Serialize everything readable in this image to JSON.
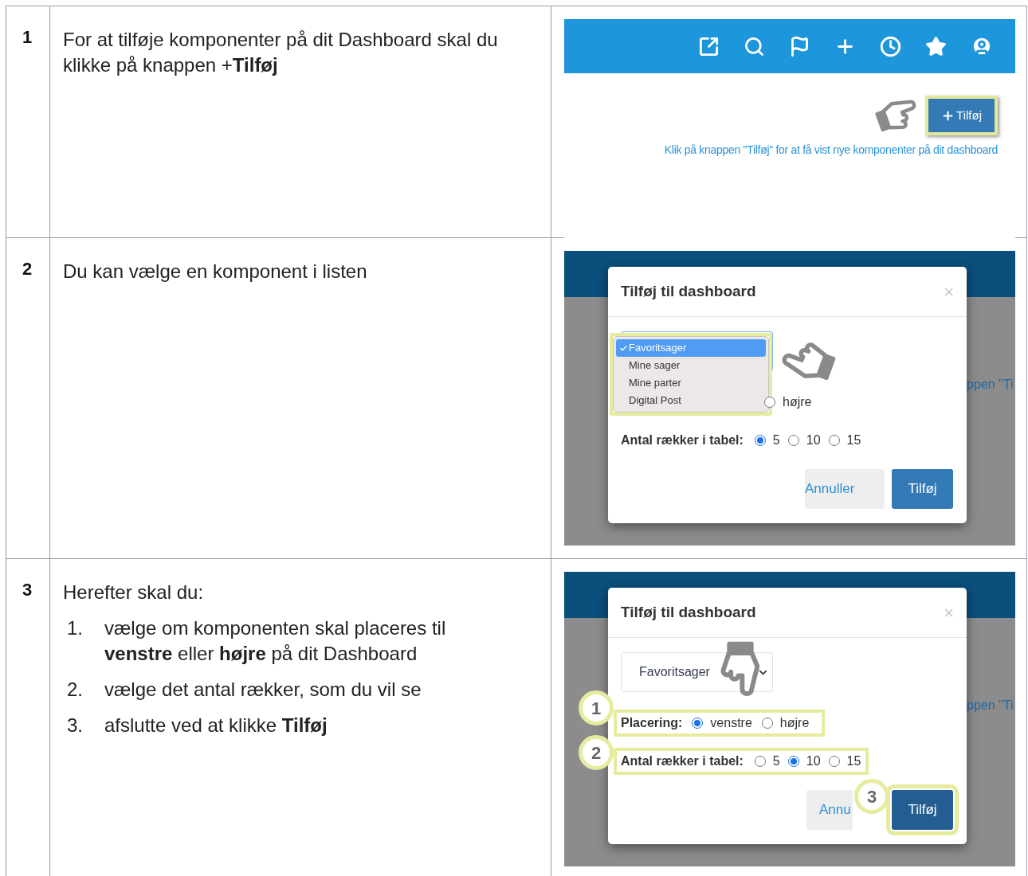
{
  "rows": [
    {
      "number": "1",
      "text": "For at tilføje komponenter på dit Dashboard skal du klikke på knappen +**Tilføj**",
      "shot": {
        "kind": "toolbar",
        "add_button": {
          "label": "Tilføj",
          "highlighted": true
        },
        "hint": "Klik på knappen \"Tilføj\" for at få vist nye komponenter på dit dashboard"
      }
    },
    {
      "number": "2",
      "text": "Du kan vælge en komponent i listen",
      "shot": {
        "kind": "dialog",
        "title": "Tilføj til dashboard",
        "close": "×",
        "background_text": "ppen \"Ti",
        "dropdown": {
          "highlighted": true,
          "options": [
            {
              "label": "Favoritsager",
              "selected": true
            },
            {
              "label": "Mine sager",
              "selected": false
            },
            {
              "label": "Mine parter",
              "selected": false
            },
            {
              "label": "Digital Post",
              "selected": false
            }
          ]
        },
        "placement": {
          "options": [
            {
              "label": "højre",
              "selected": false
            }
          ]
        },
        "rows_setting": {
          "label": "Antal rækker i tabel:",
          "options": [
            {
              "label": "5",
              "selected": true
            },
            {
              "label": "10",
              "selected": false
            },
            {
              "label": "15",
              "selected": false
            }
          ]
        },
        "cancel_button": "Annuller",
        "confirm_button": "Tilføj"
      }
    },
    {
      "number": "3",
      "intro": "Herefter skal du:",
      "steps": [
        {
          "number": "1.",
          "text": "vælge om komponenten skal placeres til **venstre** eller **højre** på dit Dashboard"
        },
        {
          "number": "2.",
          "text": "vælge det antal rækker, som du vil se"
        },
        {
          "number": "3.",
          "text": "afslutte ved at klikke **Tilføj**"
        }
      ],
      "shot": {
        "kind": "dialog",
        "title": "Tilføj til dashboard",
        "close": "×",
        "background_text": "ppen \"Ti",
        "select": {
          "value": "Favoritsager"
        },
        "placement": {
          "label": "Placering:",
          "callout": "1",
          "options": [
            {
              "label": "venstre",
              "selected": true
            },
            {
              "label": "højre",
              "selected": false
            }
          ]
        },
        "rows_setting": {
          "label": "Antal rækker i tabel:",
          "callout": "2",
          "options": [
            {
              "label": "5",
              "selected": false
            },
            {
              "label": "10",
              "selected": true
            },
            {
              "label": "15",
              "selected": false
            }
          ]
        },
        "cancel_button": "Annu",
        "confirm_button": "Tilføj",
        "confirm_callout": "3"
      }
    }
  ]
}
